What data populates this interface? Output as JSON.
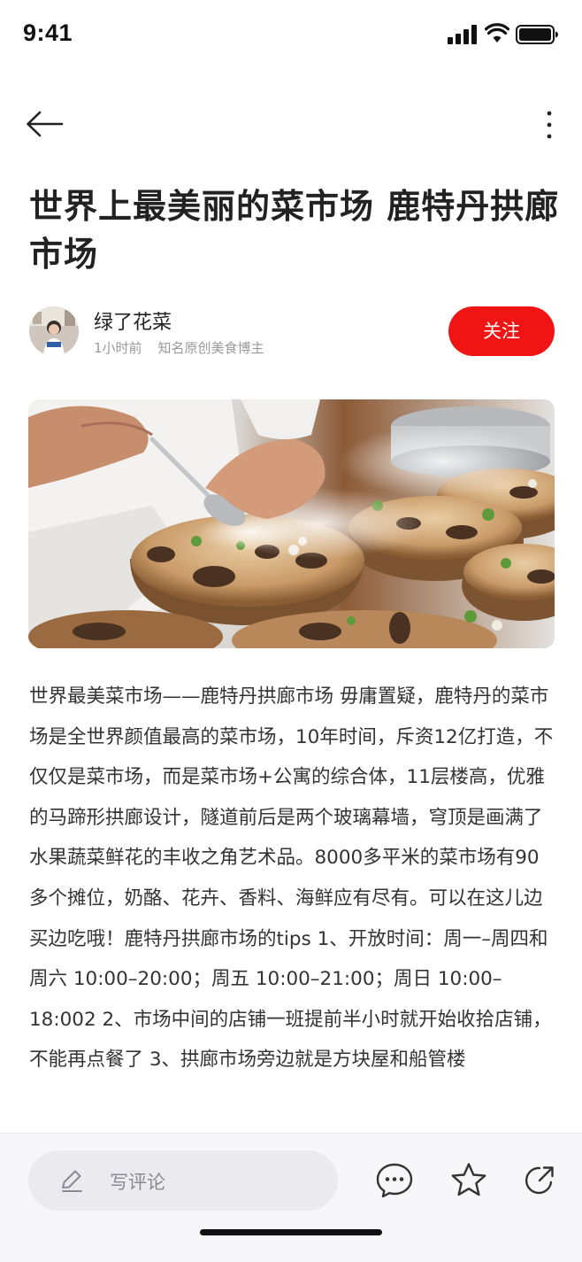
{
  "status_bar": {
    "time": "9:41"
  },
  "nav": {
    "back_icon": "arrow-left-icon",
    "more_icon": "more-vertical-icon"
  },
  "article": {
    "title": "世界上最美丽的菜市场 鹿特丹拱廊市场",
    "author": {
      "name": "绿了花菜",
      "time_ago": "1小时前",
      "description": "知名原创美食博主"
    },
    "follow_label": "关注",
    "body": "世界最美菜市场——鹿特丹拱廊市场 毋庸置疑，鹿特丹的菜市场是全世界颜值最高的菜市场，10年时间，斥资12亿打造，不仅仅是菜市场，而是菜市场+公寓的综合体，11层楼高，优雅的马蹄形拱廊设计，隧道前后是两个玻璃幕墙，穹顶是画满了水果蔬菜鲜花的丰收之角艺术品。8000多平米的菜市场有90多个摊位，奶酪、花卉、香料、海鲜应有尽有。可以在这儿边买边吃哦！鹿特丹拱廊市场的tips 1、开放时间：周一–周四和周六 10:00–20:00；周五 10:00–21:00；周日 10:00–18:002 2、市场中间的店铺一班提前半小时就开始收拾店铺，不能再点餐了 3、拱廊市场旁边就是方块屋和船管楼"
  },
  "bottom_bar": {
    "comment_placeholder": "写评论",
    "icons": [
      "pen-icon",
      "comment-icon",
      "star-icon",
      "share-icon"
    ]
  },
  "colors": {
    "accent": "#f01414",
    "text": "#333333",
    "meta": "#999999",
    "bar_bg": "#f7f7f9"
  }
}
